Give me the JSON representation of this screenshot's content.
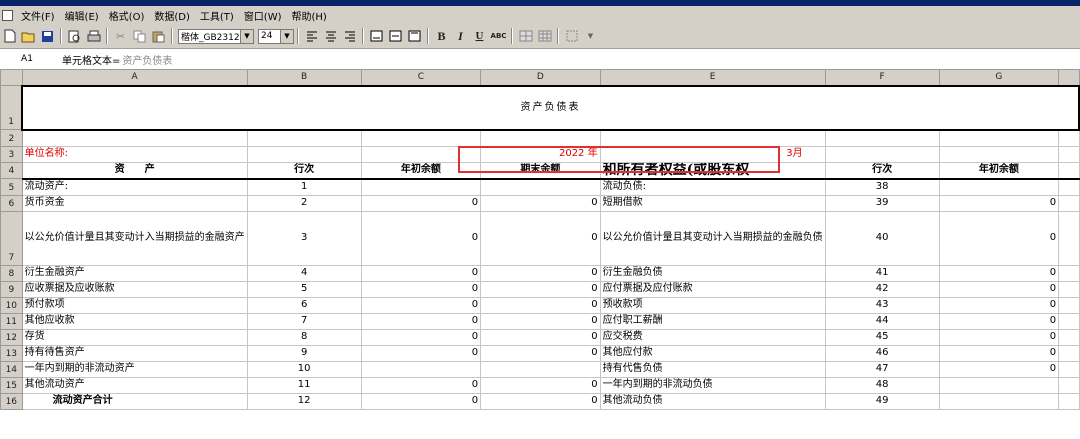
{
  "menu": [
    "文件(F)",
    "编辑(E)",
    "格式(O)",
    "数据(D)",
    "工具(T)",
    "窗口(W)",
    "帮助(H)"
  ],
  "toolbar": {
    "font_name": "楷体_GB2312",
    "font_size": "24",
    "bold": "B",
    "italic": "I",
    "underline": "U",
    "strike": "ABC"
  },
  "formula": {
    "cell_ref": "A1",
    "label": "单元格文本=",
    "value": "资产负债表"
  },
  "columns": [
    "A",
    "B",
    "C",
    "D",
    "E",
    "F",
    "G"
  ],
  "sheet": {
    "title": "资产负债表",
    "unit_label": "单位名称:",
    "year": "2022 年",
    "month": "3月",
    "headers": {
      "asset": "资　　产",
      "line": "行次",
      "opening": "年初余额",
      "closing": "期末余额",
      "liability": "和所有者权益(或股东权",
      "line2": "行次",
      "opening2": "年初余额"
    },
    "rows": [
      {
        "n": "5",
        "a": "流动资产:",
        "b": "1",
        "c": "",
        "d": "",
        "e": "流动负债:",
        "f": "38",
        "g": ""
      },
      {
        "n": "6",
        "a": "货币资金",
        "b": "2",
        "c": "0",
        "d": "0",
        "e": "短期借款",
        "f": "39",
        "g": "0"
      },
      {
        "n": "7",
        "a": "以公允价值计量且其变动计入当期损益的金融资产",
        "b": "3",
        "c": "0",
        "d": "0",
        "e": "以公允价值计量且其变动计入当期损益的金融负债",
        "f": "40",
        "g": "0"
      },
      {
        "n": "8",
        "a": "衍生金融资产",
        "b": "4",
        "c": "0",
        "d": "0",
        "e": "衍生金融负债",
        "f": "41",
        "g": "0"
      },
      {
        "n": "9",
        "a": "应收票据及应收账款",
        "b": "5",
        "c": "0",
        "d": "0",
        "e": "应付票据及应付账款",
        "f": "42",
        "g": "0"
      },
      {
        "n": "10",
        "a": "预付款项",
        "b": "6",
        "c": "0",
        "d": "0",
        "e": "预收款项",
        "f": "43",
        "g": "0"
      },
      {
        "n": "11",
        "a": "其他应收款",
        "b": "7",
        "c": "0",
        "d": "0",
        "e": "应付职工薪酬",
        "f": "44",
        "g": "0"
      },
      {
        "n": "12",
        "a": "存货",
        "b": "8",
        "c": "0",
        "d": "0",
        "e": "应交税费",
        "f": "45",
        "g": "0"
      },
      {
        "n": "13",
        "a": "持有待售资产",
        "b": "9",
        "c": "0",
        "d": "0",
        "e": "其他应付款",
        "f": "46",
        "g": "0"
      },
      {
        "n": "14",
        "a": "一年内到期的非流动资产",
        "b": "10",
        "c": "",
        "d": "",
        "e": "持有代售负债",
        "f": "47",
        "g": "0"
      },
      {
        "n": "15",
        "a": "其他流动资产",
        "b": "11",
        "c": "0",
        "d": "0",
        "e": "一年内到期的非流动负债",
        "f": "48",
        "g": ""
      },
      {
        "n": "16",
        "a": "流动资产合计",
        "b": "12",
        "c": "0",
        "d": "0",
        "e": "其他流动负债",
        "f": "49",
        "g": ""
      }
    ]
  }
}
